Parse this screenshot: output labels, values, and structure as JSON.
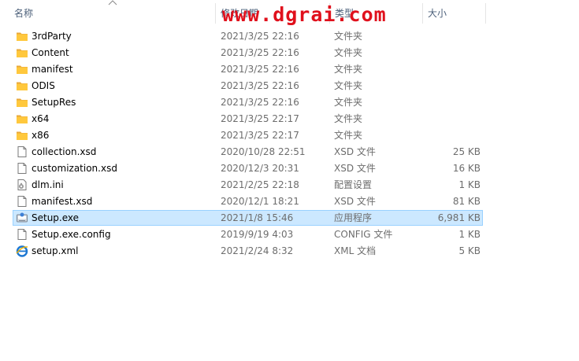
{
  "columns": {
    "name": "名称",
    "date": "修改日期",
    "type": "类型",
    "size": "大小"
  },
  "watermark": "www.dgrai.com",
  "colors": {
    "header_text": "#4c607a",
    "selected_bg": "#cce8ff",
    "selected_border": "#99d1ff",
    "folder": "#ffc83d",
    "watermark": "#e0101c"
  },
  "files": [
    {
      "name": "3rdParty",
      "date": "2021/3/25 22:16",
      "type": "文件夹",
      "size": "",
      "icon": "folder-icon"
    },
    {
      "name": "Content",
      "date": "2021/3/25 22:16",
      "type": "文件夹",
      "size": "",
      "icon": "folder-icon"
    },
    {
      "name": "manifest",
      "date": "2021/3/25 22:16",
      "type": "文件夹",
      "size": "",
      "icon": "folder-icon"
    },
    {
      "name": "ODIS",
      "date": "2021/3/25 22:16",
      "type": "文件夹",
      "size": "",
      "icon": "folder-icon"
    },
    {
      "name": "SetupRes",
      "date": "2021/3/25 22:16",
      "type": "文件夹",
      "size": "",
      "icon": "folder-icon"
    },
    {
      "name": "x64",
      "date": "2021/3/25 22:17",
      "type": "文件夹",
      "size": "",
      "icon": "folder-icon"
    },
    {
      "name": "x86",
      "date": "2021/3/25 22:17",
      "type": "文件夹",
      "size": "",
      "icon": "folder-icon"
    },
    {
      "name": "collection.xsd",
      "date": "2020/10/28 22:51",
      "type": "XSD 文件",
      "size": "25 KB",
      "icon": "file-icon"
    },
    {
      "name": "customization.xsd",
      "date": "2020/12/3 20:31",
      "type": "XSD 文件",
      "size": "16 KB",
      "icon": "file-icon"
    },
    {
      "name": "dlm.ini",
      "date": "2021/2/25 22:18",
      "type": "配置设置",
      "size": "1 KB",
      "icon": "settings-file-icon"
    },
    {
      "name": "manifest.xsd",
      "date": "2020/12/1 18:21",
      "type": "XSD 文件",
      "size": "81 KB",
      "icon": "file-icon"
    },
    {
      "name": "Setup.exe",
      "date": "2021/1/8 15:46",
      "type": "应用程序",
      "size": "6,981 KB",
      "icon": "setup-exe-icon",
      "selected": true
    },
    {
      "name": "Setup.exe.config",
      "date": "2019/9/19 4:03",
      "type": "CONFIG 文件",
      "size": "1 KB",
      "icon": "file-icon"
    },
    {
      "name": "setup.xml",
      "date": "2021/2/24 8:32",
      "type": "XML 文档",
      "size": "5 KB",
      "icon": "ie-document-icon"
    }
  ]
}
